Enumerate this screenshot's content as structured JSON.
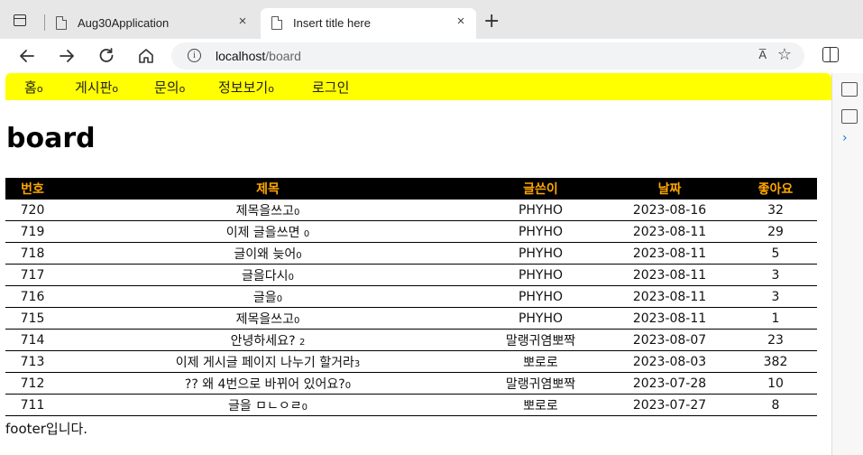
{
  "browser": {
    "tabs": [
      {
        "title": "Aug30Application",
        "active": false,
        "close": "×"
      },
      {
        "title": "Insert title here",
        "active": true,
        "close": "×"
      }
    ],
    "new_tab": "+",
    "url_host": "localhost",
    "url_path": "/board",
    "read_aloud": "A̅",
    "favorite": "☆"
  },
  "menu": {
    "items": [
      {
        "label": "홈",
        "marker": "o"
      },
      {
        "label": "게시판",
        "marker": "o"
      },
      {
        "label": "문의",
        "marker": "o"
      },
      {
        "label": "정보보기",
        "marker": "o"
      },
      {
        "label": "로그인",
        "marker": ""
      }
    ]
  },
  "page_title": "board",
  "table": {
    "headers": [
      "번호",
      "제목",
      "글쓴이",
      "날짜",
      "좋아요"
    ],
    "rows": [
      {
        "no": "720",
        "title": "제목을쓰고",
        "count": "0",
        "writer": "PHYHO",
        "date": "2023-08-16",
        "likes": "32"
      },
      {
        "no": "719",
        "title": "이제 글을쓰면 ",
        "count": "0",
        "writer": "PHYHO",
        "date": "2023-08-11",
        "likes": "29"
      },
      {
        "no": "718",
        "title": "글이왜 늦어",
        "count": "0",
        "writer": "PHYHO",
        "date": "2023-08-11",
        "likes": "5"
      },
      {
        "no": "717",
        "title": "글을다시",
        "count": "0",
        "writer": "PHYHO",
        "date": "2023-08-11",
        "likes": "3"
      },
      {
        "no": "716",
        "title": "글을",
        "count": "0",
        "writer": "PHYHO",
        "date": "2023-08-11",
        "likes": "3"
      },
      {
        "no": "715",
        "title": "제목을쓰고",
        "count": "0",
        "writer": "PHYHO",
        "date": "2023-08-11",
        "likes": "1"
      },
      {
        "no": "714",
        "title": "안녕하세요? ",
        "count": "2",
        "writer": "말랭귀염뽀짝",
        "date": "2023-08-07",
        "likes": "23"
      },
      {
        "no": "713",
        "title": "이제 게시글 페이지 나누기 할거라",
        "count": "3",
        "writer": "뽀로로",
        "date": "2023-08-03",
        "likes": "382"
      },
      {
        "no": "712",
        "title": "?? 왜 4번으로 바뀌어 있어요?",
        "count": "0",
        "writer": "말랭귀염뽀짝",
        "date": "2023-07-28",
        "likes": "10"
      },
      {
        "no": "711",
        "title": "글을 ㅁㄴㅇㄹ",
        "count": "0",
        "writer": "뽀로로",
        "date": "2023-07-27",
        "likes": "8"
      }
    ]
  },
  "footer": "footer입니다."
}
